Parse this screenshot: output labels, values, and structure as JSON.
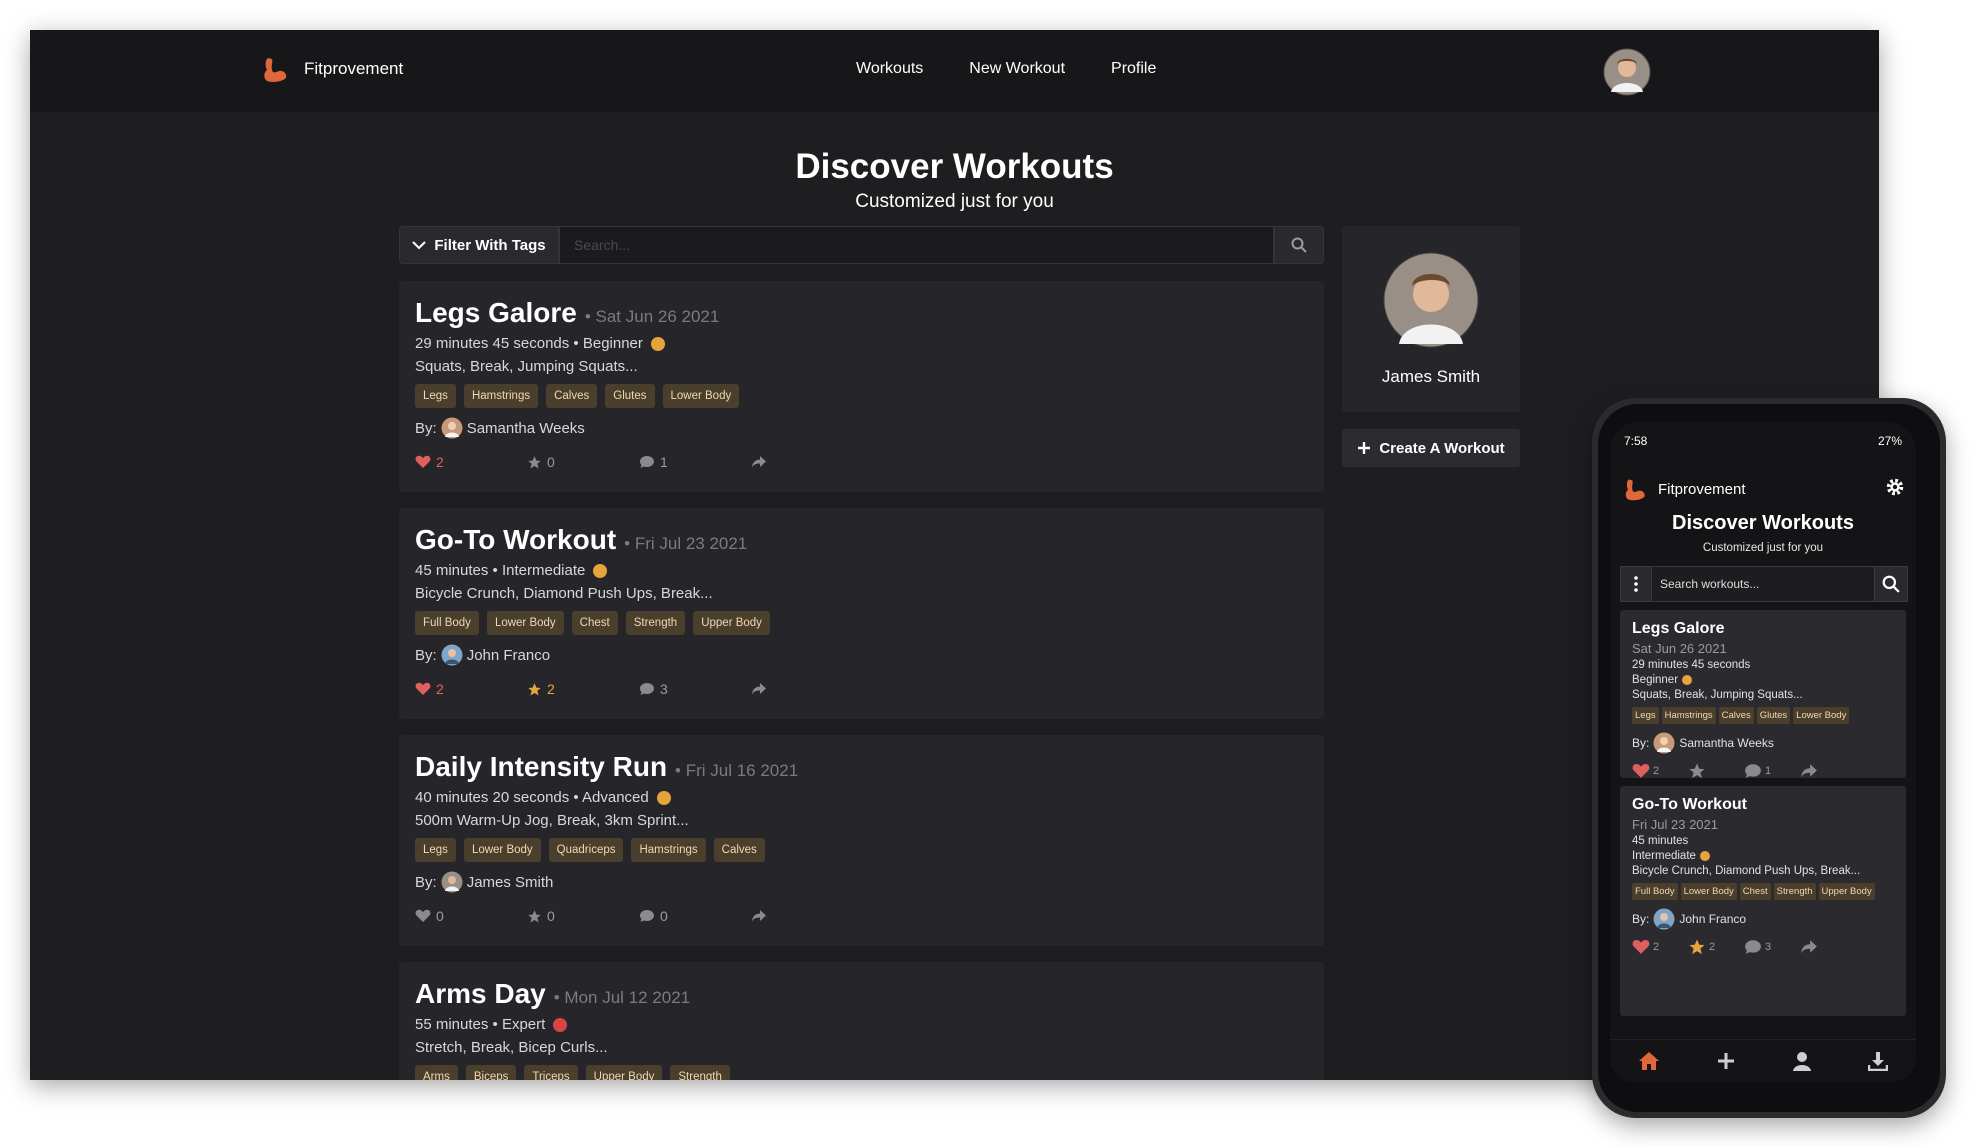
{
  "colors": {
    "accent": "#e0673a",
    "like": "#e06060",
    "star": "#e8a43c",
    "tag_bg": "#4a3e2c"
  },
  "navbar": {
    "brand": "Fitprovement",
    "links": [
      "Workouts",
      "New Workout",
      "Profile"
    ]
  },
  "page": {
    "title": "Discover Workouts",
    "subtitle": "Customized just for you"
  },
  "toolbar": {
    "filter_label": "Filter With Tags",
    "search_placeholder": "Search..."
  },
  "profile": {
    "name": "James Smith",
    "create_label": "Create A Workout"
  },
  "workouts": [
    {
      "title": "Legs Galore",
      "date": "• Sat Jun 26 2021",
      "duration": "29 minutes 45 seconds • Beginner",
      "exercises": "Squats, Break, Jumping Squats...",
      "tags": [
        "Legs",
        "Hamstrings",
        "Calves",
        "Glutes",
        "Lower Body"
      ],
      "author": "Samantha Weeks",
      "likes": "2",
      "stars": "0",
      "comments": "1"
    },
    {
      "title": "Go-To Workout",
      "date": "• Fri Jul 23 2021",
      "duration": "45 minutes • Intermediate",
      "exercises": "Bicycle Crunch, Diamond Push Ups, Break...",
      "tags": [
        "Full Body",
        "Lower Body",
        "Chest",
        "Strength",
        "Upper Body"
      ],
      "author": "John Franco",
      "likes": "2",
      "stars": "2",
      "comments": "3"
    },
    {
      "title": "Daily Intensity Run",
      "date": "• Fri Jul 16 2021",
      "duration": "40 minutes 20 seconds • Advanced",
      "exercises": "500m Warm-Up Jog, Break, 3km Sprint...",
      "tags": [
        "Legs",
        "Lower Body",
        "Quadriceps",
        "Hamstrings",
        "Calves"
      ],
      "author": "James Smith",
      "likes": "0",
      "stars": "0",
      "comments": "0"
    },
    {
      "title": "Arms Day",
      "date": "• Mon Jul 12 2021",
      "duration": "55 minutes • Expert",
      "exercises": "Stretch, Break, Bicep Curls...",
      "tags": [
        "Arms",
        "Biceps",
        "Triceps",
        "Upper Body",
        "Strength"
      ],
      "author": "",
      "likes": "",
      "stars": "",
      "comments": ""
    }
  ],
  "by_label": "By:",
  "phone": {
    "time": "7:58",
    "battery": "27%",
    "brand": "Fitprovement",
    "title": "Discover Workouts",
    "subtitle": "Customized just for you",
    "search_placeholder": "Search workouts...",
    "cards": [
      {
        "title": "Legs Galore",
        "date": "Sat Jun 26 2021",
        "duration": "29 minutes 45 seconds",
        "level": "Beginner",
        "exercises": "Squats, Break, Jumping Squats...",
        "tags": [
          "Legs",
          "Hamstrings",
          "Calves",
          "Glutes",
          "Lower Body"
        ],
        "author": "Samantha Weeks",
        "likes": "2",
        "stars": "",
        "comments": "1"
      },
      {
        "title": "Go-To Workout",
        "date": "Fri Jul 23 2021",
        "duration": "45 minutes",
        "level": "Intermediate",
        "exercises": "Bicycle Crunch, Diamond Push Ups, Break...",
        "tags": [
          "Full Body",
          "Lower Body",
          "Chest",
          "Strength",
          "Upper Body"
        ],
        "author": "John Franco",
        "likes": "2",
        "stars": "2",
        "comments": "3"
      }
    ]
  }
}
